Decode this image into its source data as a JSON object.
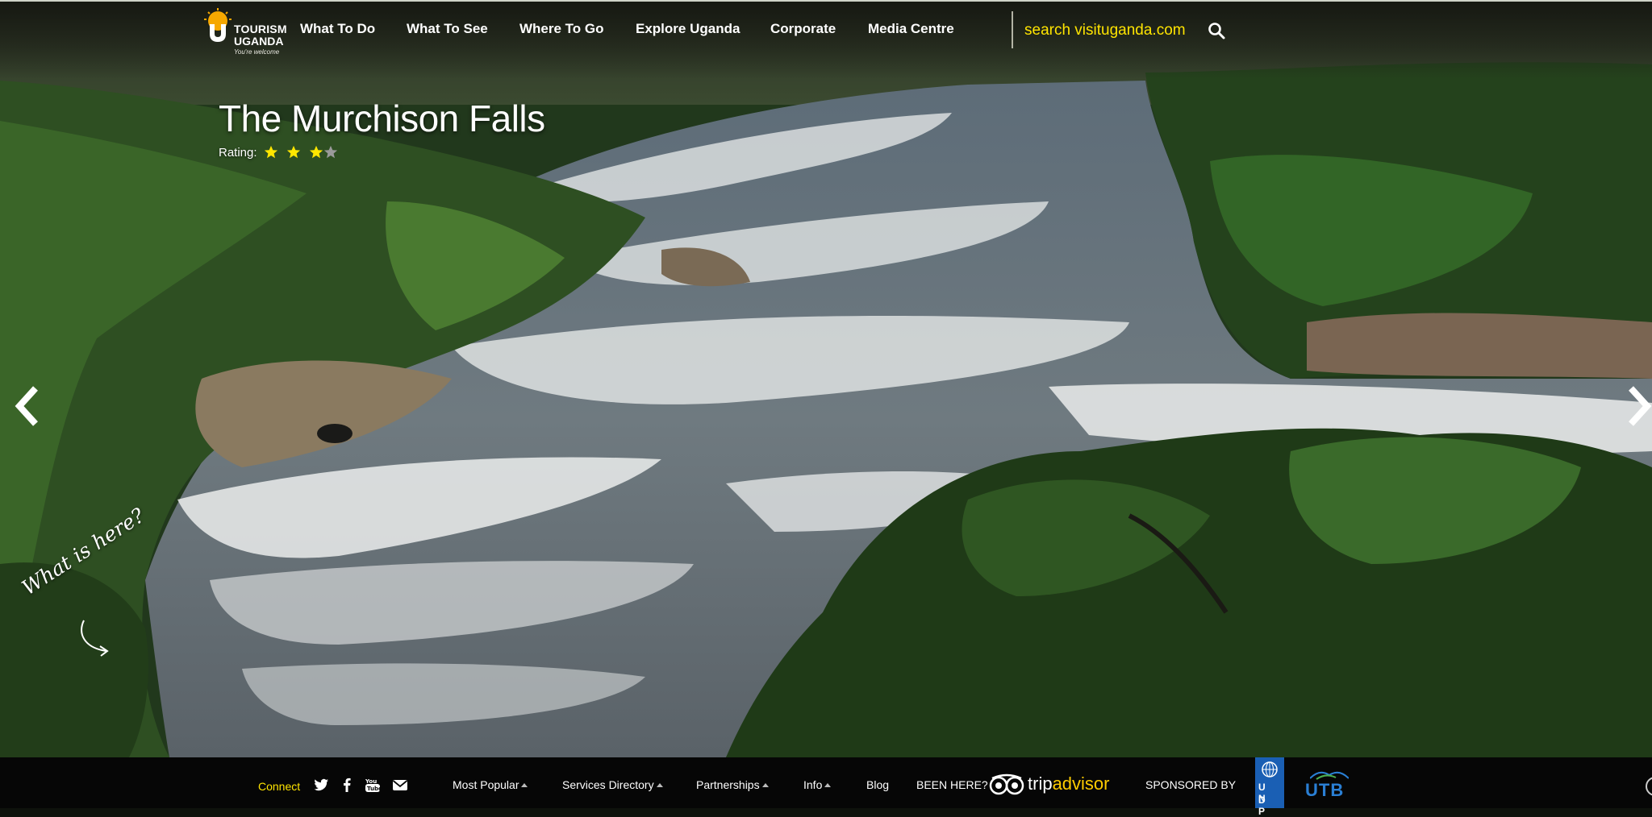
{
  "brand": {
    "line1": "TOURISM",
    "line2": "UGANDA",
    "tagline": "You're welcome"
  },
  "nav": {
    "items": [
      {
        "label": "What To Do"
      },
      {
        "label": "What To See"
      },
      {
        "label": "Where To Go"
      },
      {
        "label": "Explore Uganda"
      },
      {
        "label": "Corporate"
      },
      {
        "label": "Media Centre"
      }
    ],
    "search_placeholder": "search visituganda.com"
  },
  "hero": {
    "title": "The Murchison Falls",
    "rating_label": "Rating:",
    "rating_value": 3,
    "rating_max": 4,
    "what_is_here": "What is here?"
  },
  "footer": {
    "connect_label": "Connect",
    "social_icons": [
      "twitter-icon",
      "facebook-icon",
      "youtube-icon",
      "email-icon"
    ],
    "links": [
      {
        "label": "Most Popular"
      },
      {
        "label": "Services Directory"
      },
      {
        "label": "Partnerships"
      },
      {
        "label": "Info"
      },
      {
        "label": "Blog"
      }
    ],
    "been_here": "BEEN HERE?",
    "tripadvisor_trip": "trip",
    "tripadvisor_advisor": "advisor",
    "sponsored_by": "SPONSORED BY",
    "undp_line1": "U N",
    "undp_line2": "D P",
    "utb_label": "UTB"
  },
  "colors": {
    "accent_yellow": "#ffe400",
    "footer_bg": "#060606",
    "star_gold": "#ffe600",
    "star_grey": "#9a9a9a"
  }
}
